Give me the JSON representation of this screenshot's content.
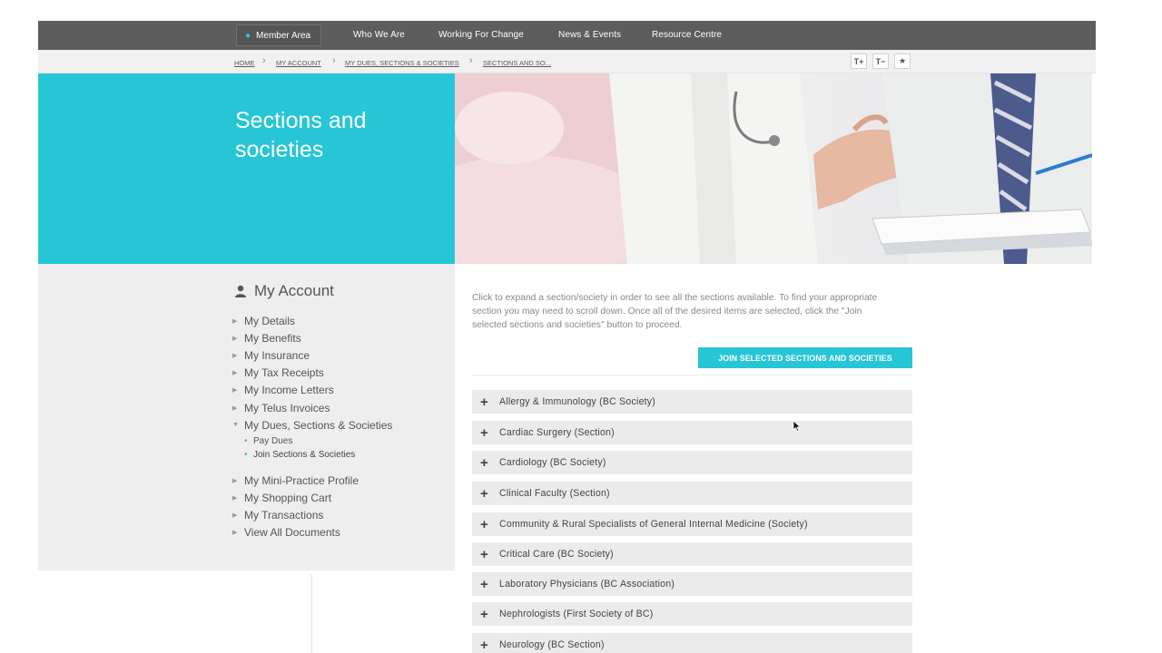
{
  "topnav": {
    "member_area": "Member Area",
    "links": [
      "Who We Are",
      "Working For Change",
      "News & Events",
      "Resource Centre"
    ]
  },
  "breadcrumb": {
    "items": [
      "HOME",
      "MY ACCOUNT",
      "MY DUES, SECTIONS & SOCIETIES",
      "SECTIONS AND SO..."
    ],
    "tools": [
      "T+",
      "T−",
      "★"
    ]
  },
  "hero": {
    "title": "Sections and\nsocieties"
  },
  "sidebar": {
    "title": "My Account",
    "items": [
      "My Details",
      "My Benefits",
      "My Insurance",
      "My Tax Receipts",
      "My Income Letters",
      "My Telus Invoices",
      "My Dues, Sections & Societies"
    ],
    "subitems": [
      "Pay Dues",
      "Join Sections & Societies"
    ],
    "items_after": [
      "My Mini-Practice Profile",
      "My Shopping Cart",
      "My Transactions",
      "View All Documents"
    ]
  },
  "main": {
    "intro": "Click to expand a section/society in order to see all the sections available. To find your appropriate section you may need to scroll down. Once all of the desired items are selected, click the \"Join selected sections and societies\" button to proceed.",
    "join_button": "JOIN SELECTED SECTIONS AND SOCIETIES",
    "sections": [
      "Allergy & Immunology (BC Society)",
      "Cardiac Surgery (Section)",
      "Cardiology (BC Society)",
      "Clinical Faculty (Section)",
      "Community & Rural Specialists of General Internal Medicine (Society)",
      "Critical Care (BC Society)",
      "Laboratory Physicians (BC Association)",
      "Nephrologists (First Society of BC)",
      "Neurology (BC Section)"
    ]
  },
  "colors": {
    "accent": "#26c6d6",
    "nav_bg": "#5d5d5d",
    "sidebar_bg": "#eeeeee",
    "accordion_bg": "#ebebeb"
  }
}
